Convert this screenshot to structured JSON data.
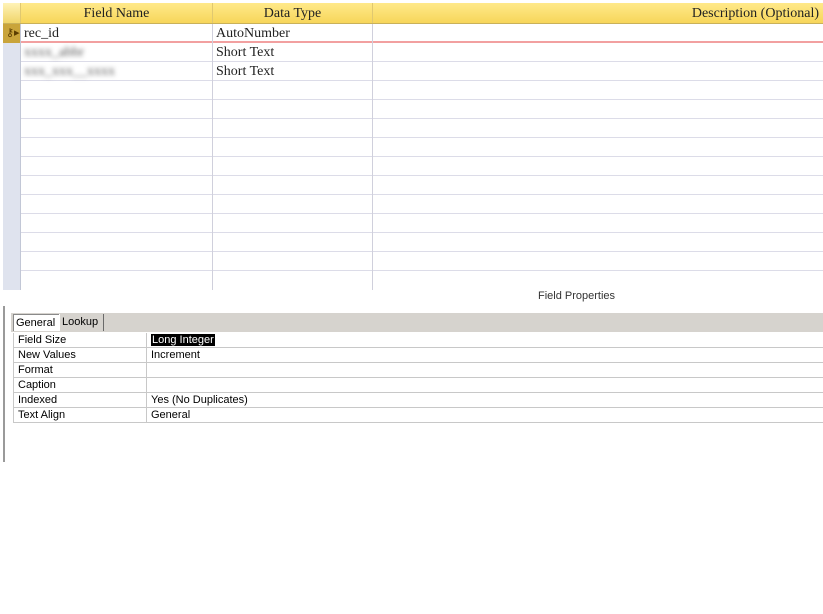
{
  "grid": {
    "headers": {
      "field_name": "Field Name",
      "data_type": "Data Type",
      "description": "Description (Optional)"
    },
    "rows": [
      {
        "field_name": "rec_id",
        "data_type": "AutoNumber",
        "is_primary_key": true,
        "is_current": true
      },
      {
        "field_name": "",
        "data_type": "Short Text"
      },
      {
        "field_name": "",
        "data_type": "Short Text"
      }
    ]
  },
  "field_properties": {
    "title": "Field Properties",
    "tabs": [
      "General",
      "Lookup"
    ],
    "active_tab": "General",
    "properties": [
      {
        "label": "Field Size",
        "value": "Long Integer",
        "selected": true
      },
      {
        "label": "New Values",
        "value": "Increment"
      },
      {
        "label": "Format",
        "value": ""
      },
      {
        "label": "Caption",
        "value": ""
      },
      {
        "label": "Indexed",
        "value": "Yes (No Duplicates)"
      },
      {
        "label": "Text Align",
        "value": "General"
      }
    ]
  },
  "icons": {
    "primary_key": "key-icon"
  },
  "colors": {
    "header": "#f7d65a",
    "selector": "#dfe3ee",
    "active_row_line": "#f2a0a0"
  }
}
